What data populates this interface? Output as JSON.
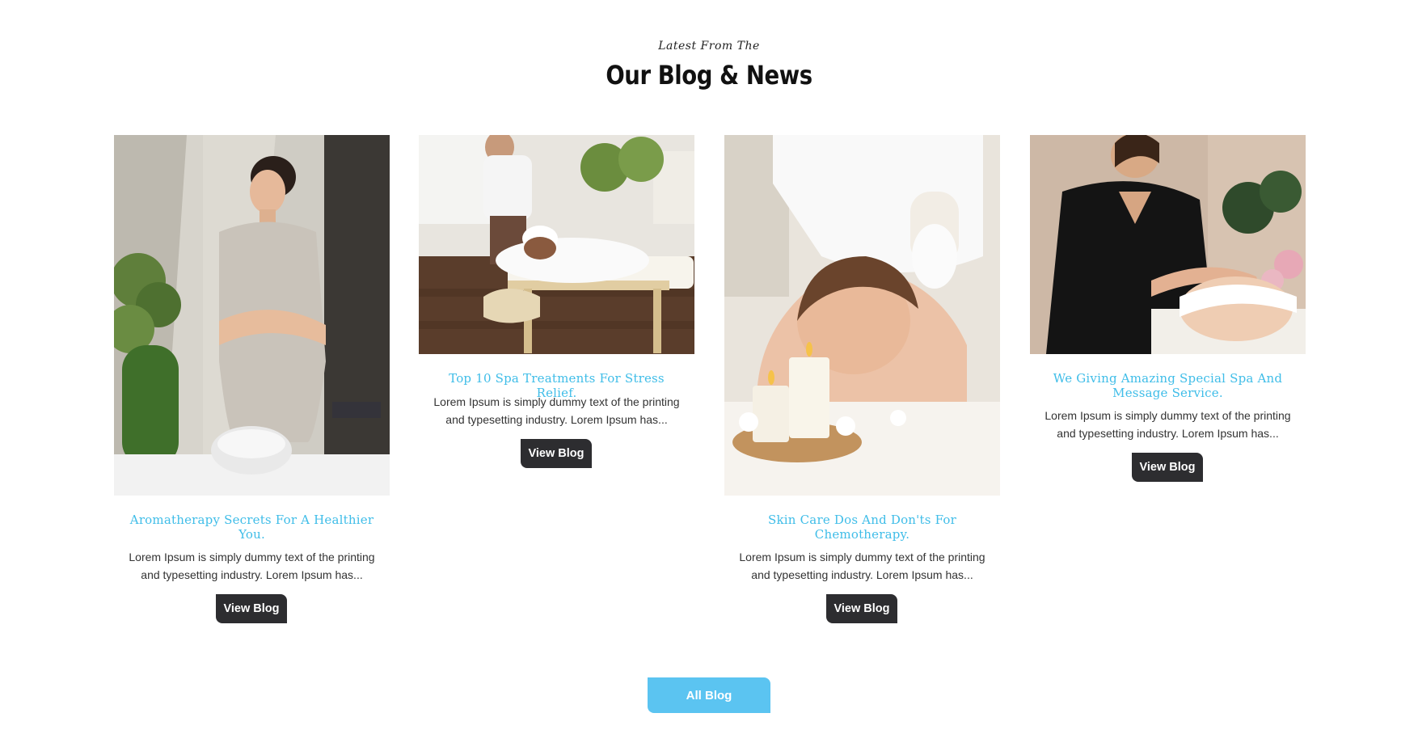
{
  "section": {
    "kicker": "Latest From The",
    "heading": "Our Blog & News"
  },
  "posts": [
    {
      "title": "Aromatherapy Secrets For A Healthier You.",
      "excerpt": "Lorem Ipsum is simply dummy text of the printing and typesetting industry. Lorem Ipsum has...",
      "button_label": "View Blog",
      "image": "therapist-with-towel-photo"
    },
    {
      "title": "Top 10 Spa Treatments For Stress Relief.",
      "excerpt": "Lorem Ipsum is simply dummy text of the printing and typesetting industry. Lorem Ipsum has...",
      "button_label": "View Blog",
      "image": "back-massage-photo"
    },
    {
      "title": "Skin Care Dos And Don'ts For Chemotherapy.",
      "excerpt": "Lorem Ipsum is simply dummy text of the printing and typesetting industry. Lorem Ipsum has...",
      "button_label": "View Blog",
      "image": "herbal-compress-candles-photo"
    },
    {
      "title": "We Giving Amazing Special Spa And Message Service.",
      "excerpt": "Lorem Ipsum is simply dummy text of the printing and typesetting industry. Lorem Ipsum has...",
      "button_label": "View Blog",
      "image": "facial-massage-photo"
    }
  ],
  "all_blog_label": "All Blog",
  "colors": {
    "title_accent": "#3fbde8",
    "view_button": "#2d2d30",
    "all_button": "#5bc4f1"
  }
}
